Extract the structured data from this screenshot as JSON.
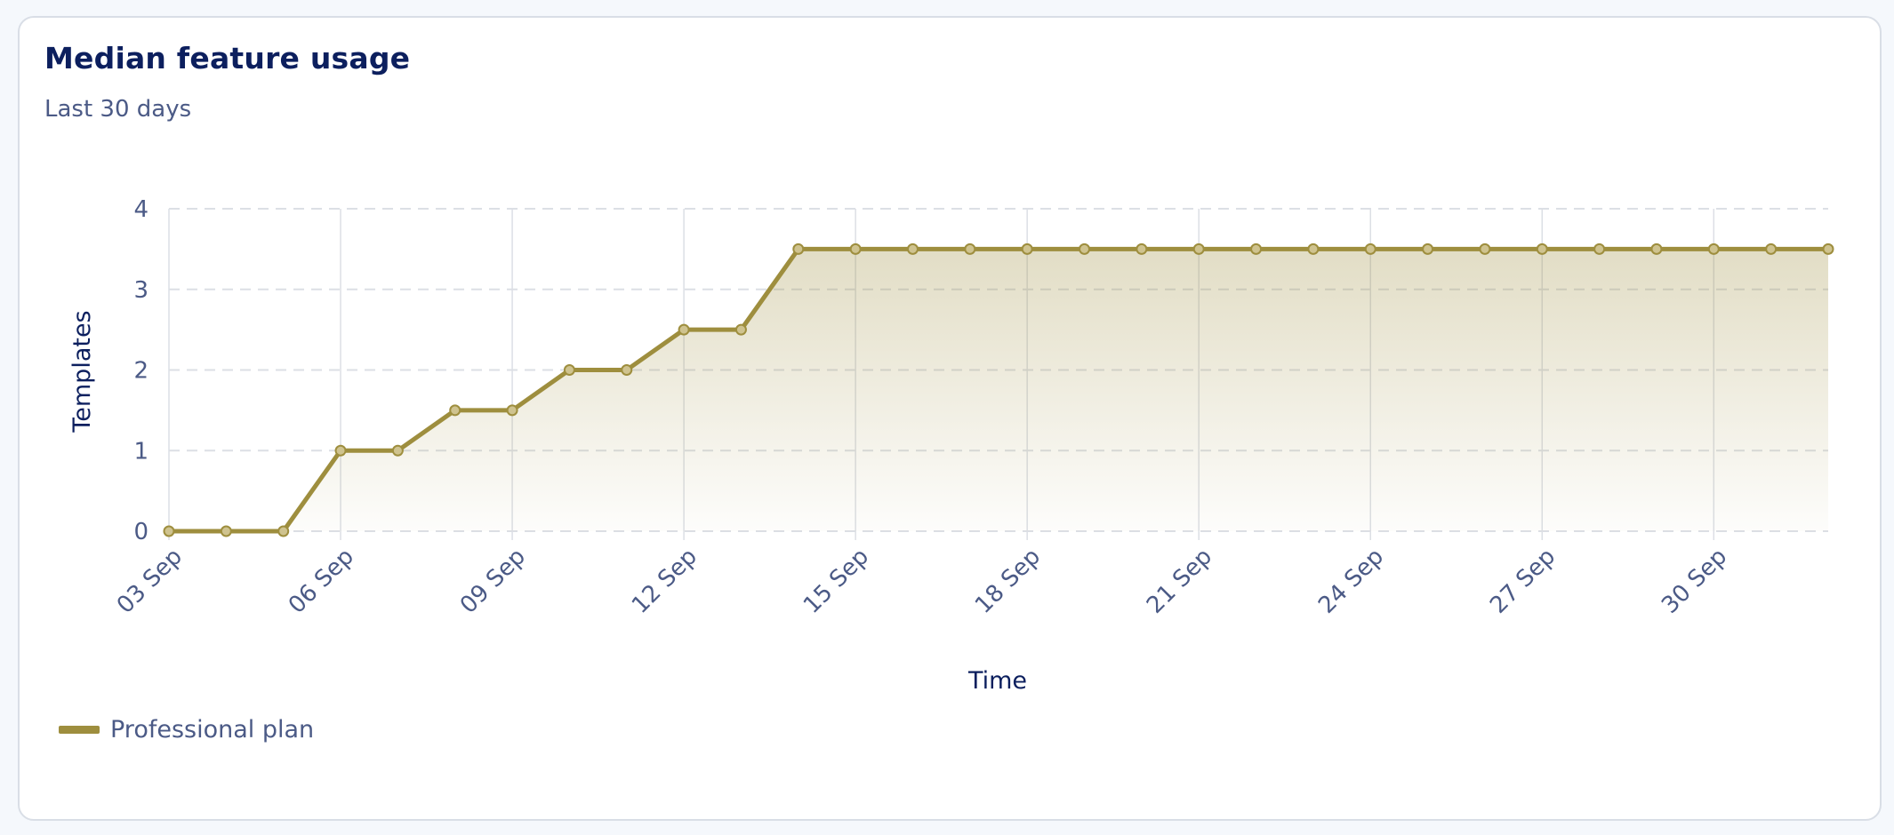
{
  "card": {
    "title": "Median feature usage",
    "subtitle": "Last 30 days"
  },
  "colors": {
    "series": "#9e8e3e",
    "grid": "#dcdfe5",
    "text": "#4b5a86",
    "title": "#0c1f5e"
  },
  "chart_data": {
    "type": "area",
    "title": "Median feature usage",
    "subtitle": "Last 30 days",
    "xlabel": "Time",
    "ylabel": "Templates",
    "x": [
      "03 Sep",
      "04 Sep",
      "05 Sep",
      "06 Sep",
      "07 Sep",
      "08 Sep",
      "09 Sep",
      "10 Sep",
      "11 Sep",
      "12 Sep",
      "13 Sep",
      "14 Sep",
      "15 Sep",
      "16 Sep",
      "17 Sep",
      "18 Sep",
      "19 Sep",
      "20 Sep",
      "21 Sep",
      "22 Sep",
      "23 Sep",
      "24 Sep",
      "25 Sep",
      "26 Sep",
      "27 Sep",
      "28 Sep",
      "29 Sep",
      "30 Sep",
      "01 Oct",
      "02 Oct"
    ],
    "x_tick_labels": [
      "03 Sep",
      "06 Sep",
      "09 Sep",
      "12 Sep",
      "15 Sep",
      "18 Sep",
      "21 Sep",
      "24 Sep",
      "27 Sep",
      "30 Sep"
    ],
    "y_ticks": [
      0,
      1,
      2,
      3,
      4
    ],
    "ylim": [
      0,
      4
    ],
    "grid": true,
    "legend_position": "bottom-left",
    "series": [
      {
        "name": "Professional plan",
        "color": "#9e8e3e",
        "values": [
          0,
          0,
          0,
          1,
          1,
          1.5,
          1.5,
          2,
          2,
          2.5,
          2.5,
          3.5,
          3.5,
          3.5,
          3.5,
          3.5,
          3.5,
          3.5,
          3.5,
          3.5,
          3.5,
          3.5,
          3.5,
          3.5,
          3.5,
          3.5,
          3.5,
          3.5,
          3.5,
          3.5
        ]
      }
    ]
  }
}
